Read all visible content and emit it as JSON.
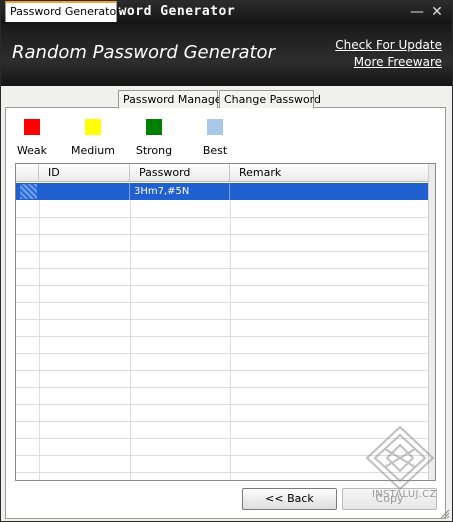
{
  "window": {
    "title": "Random Password Generator",
    "min_glyph": "—",
    "close_glyph": "✕"
  },
  "header": {
    "app_title": "Random Password Generator",
    "links": [
      "Check For Update",
      "More Freeware"
    ]
  },
  "tabs": [
    "Password Generator",
    "Password Manager",
    "Change Password"
  ],
  "active_tab": "Password Generator",
  "strength_legend": [
    {
      "label": "Weak",
      "color": "#ff0000"
    },
    {
      "label": "Medium",
      "color": "#ffff00"
    },
    {
      "label": "Strong",
      "color": "#008000"
    },
    {
      "label": "Best",
      "color": "#a8c8e8"
    }
  ],
  "grid": {
    "columns": [
      "ID",
      "Password",
      "Remark"
    ],
    "rows": [
      {
        "id": "",
        "password": "3Hm7,#5N",
        "remark": "",
        "selected": true
      }
    ]
  },
  "buttons": {
    "back": "<< Back",
    "copy": "Copy"
  },
  "watermark": {
    "text": "INSTALUJ.CZ"
  }
}
